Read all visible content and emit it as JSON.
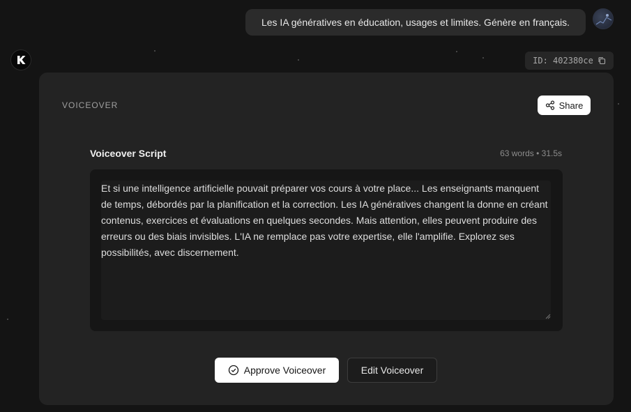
{
  "chat": {
    "user_message": "Les IA génératives en éducation, usages et limites. Génère en français."
  },
  "result": {
    "id_label": "ID: 402380ce",
    "section_label": "VOICEOVER",
    "share_label": "Share",
    "script_title": "Voiceover Script",
    "script_meta": "63 words • 31.5s",
    "script_text": "Et si une intelligence artificielle pouvait préparer vos cours à votre place... Les enseignants manquent de temps, débordés par la planification et la correction. Les IA génératives changent la donne en créant contenus, exercices et évaluations en quelques secondes. Mais attention, elles peuvent produire des erreurs ou des biais invisibles. L'IA ne remplace pas votre expertise, elle l'amplifie. Explorez ses possibilités, avec discernement.",
    "approve_label": "Approve Voiceover",
    "edit_label": "Edit Voiceover"
  },
  "icons": {
    "bot_logo": "k-logo-icon",
    "copy": "copy-icon",
    "share": "share-icon",
    "approve": "check-circle-icon"
  }
}
